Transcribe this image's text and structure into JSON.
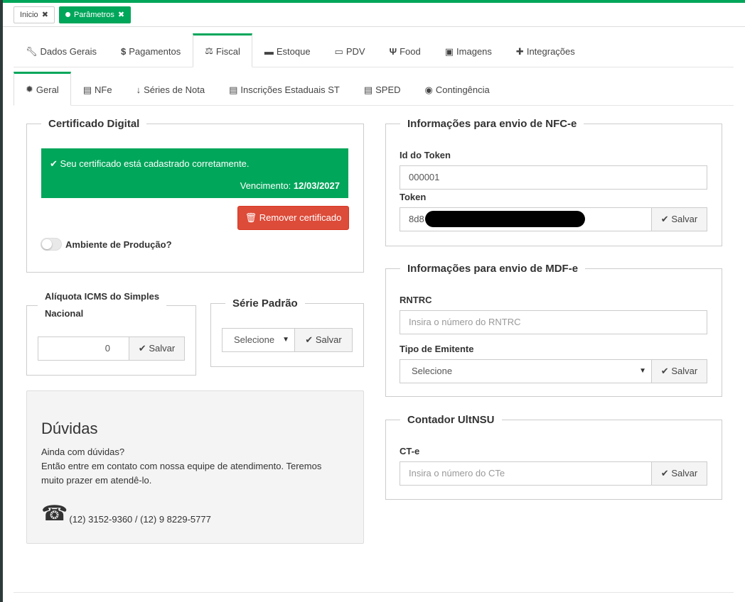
{
  "page_tabs": {
    "inicio": "Inicio",
    "parametros": "Parâmetros"
  },
  "main_tabs": [
    {
      "label": "Dados Gerais",
      "icon": "wrench-icon"
    },
    {
      "label": "Pagamentos",
      "icon": "dollar-icon"
    },
    {
      "label": "Fiscal",
      "icon": "balance-scale-icon"
    },
    {
      "label": "Estoque",
      "icon": "archive-icon"
    },
    {
      "label": "PDV",
      "icon": "desktop-icon"
    },
    {
      "label": "Food",
      "icon": "cutlery-icon"
    },
    {
      "label": "Imagens",
      "icon": "image-icon"
    },
    {
      "label": "Integrações",
      "icon": "puzzle-icon"
    }
  ],
  "sub_tabs": [
    {
      "label": "Geral",
      "icon": "gear-icon"
    },
    {
      "label": "NFe",
      "icon": "file-icon"
    },
    {
      "label": "Séries de Nota",
      "icon": "sort-numeric-icon"
    },
    {
      "label": "Inscrições Estaduais ST",
      "icon": "file-text-icon"
    },
    {
      "label": "SPED",
      "icon": "file-text-icon"
    },
    {
      "label": "Contingência",
      "icon": "globe-icon"
    }
  ],
  "certificado": {
    "title": "Certificado Digital",
    "status_message": "Seu certificado está cadastrado corretamente.",
    "vencimento_label": "Vencimento:",
    "vencimento_value": "12/03/2027",
    "remove_button": "Remover certificado",
    "ambiente_label": "Ambiente de Produção?"
  },
  "aliquota": {
    "title_line1": "Alíquota ICMS do Simples",
    "title_line2": "Nacional",
    "value": "0",
    "save": "Salvar"
  },
  "serie": {
    "title": "Série Padrão",
    "selected": "Selecione",
    "save": "Salvar"
  },
  "duvidas": {
    "title": "Dúvidas",
    "line1": "Ainda com dúvidas?",
    "line2": "Então entre em contato com nossa equipe de atendimento. Teremos muito prazer em atendê-lo.",
    "phones": "(12) 3152-9360 / (12) 9 8229-5777"
  },
  "nfce": {
    "title": "Informações para envio de NFC-e",
    "id_label": "Id do Token",
    "id_value": "000001",
    "token_label": "Token",
    "token_value": "8d8",
    "save": "Salvar"
  },
  "mdfe": {
    "title": "Informações para envio de MDF-e",
    "rntrc_label": "RNTRC",
    "rntrc_placeholder": "Insira o número do RNTRC",
    "emitente_label": "Tipo de Emitente",
    "emitente_selected": "Selecione",
    "save": "Salvar"
  },
  "ultnsu": {
    "title": "Contador UltNSU",
    "cte_label": "CT-e",
    "cte_placeholder": "Insira o número do CTe",
    "save": "Salvar"
  },
  "colors": {
    "accent": "#00a65a",
    "danger": "#dd4b39"
  }
}
